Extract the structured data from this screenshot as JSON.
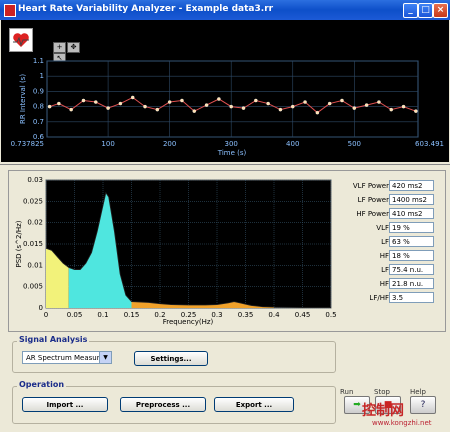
{
  "window": {
    "title": "Heart Rate Variability Analyzer  -  Example data3.rr",
    "buttons": {
      "minimize": "_",
      "maximize": "□",
      "close": "×"
    }
  },
  "rr_chart": {
    "toolbar_icons": [
      "zoom-icon",
      "pan-icon",
      "cursor-icon"
    ],
    "ylabel": "RR Interval (s)",
    "xlabel": "Time (s)",
    "x_start_label": "0.737825",
    "x_end_label": "603.491",
    "x_ticks": [
      "100",
      "200",
      "300",
      "400",
      "500"
    ],
    "y_ticks": [
      "1.1",
      "1",
      "0.9",
      "0.8",
      "0.7",
      "0.6"
    ]
  },
  "chart_data": [
    {
      "type": "scatter",
      "xlabel": "Time (s)",
      "ylabel": "RR Interval (s)",
      "xlim": [
        0.737825,
        603.491
      ],
      "ylim": [
        0.6,
        1.1
      ],
      "series": [
        {
          "x": [
            5,
            20,
            40,
            60,
            80,
            100,
            120,
            140,
            160,
            180,
            200,
            220,
            240,
            260,
            280,
            300,
            320,
            340,
            360,
            380,
            400,
            420,
            440,
            460,
            480,
            500,
            520,
            540,
            560,
            580,
            600
          ],
          "values": [
            0.8,
            0.82,
            0.78,
            0.84,
            0.83,
            0.79,
            0.82,
            0.86,
            0.8,
            0.78,
            0.83,
            0.84,
            0.77,
            0.81,
            0.85,
            0.8,
            0.79,
            0.84,
            0.82,
            0.78,
            0.8,
            0.83,
            0.76,
            0.82,
            0.84,
            0.79,
            0.81,
            0.83,
            0.78,
            0.8,
            0.77
          ]
        }
      ]
    },
    {
      "type": "area",
      "xlabel": "Frequency(Hz)",
      "ylabel": "PSD (s^2/Hz)",
      "xlim": [
        0,
        0.5
      ],
      "ylim": [
        0,
        0.03
      ],
      "x": [
        0,
        0.01,
        0.02,
        0.03,
        0.04,
        0.05,
        0.06,
        0.07,
        0.08,
        0.09,
        0.1,
        0.105,
        0.11,
        0.12,
        0.13,
        0.14,
        0.15,
        0.18,
        0.2,
        0.22,
        0.25,
        0.28,
        0.3,
        0.32,
        0.33,
        0.34,
        0.36,
        0.38,
        0.4,
        0.45,
        0.5
      ],
      "values": [
        0.014,
        0.0135,
        0.012,
        0.0105,
        0.0095,
        0.009,
        0.009,
        0.0105,
        0.013,
        0.018,
        0.024,
        0.027,
        0.026,
        0.018,
        0.008,
        0.003,
        0.0015,
        0.0013,
        0.001,
        0.0008,
        0.0007,
        0.0007,
        0.0008,
        0.0012,
        0.0015,
        0.0012,
        0.0006,
        0.0003,
        0.0002,
        0.0001,
        0.0001
      ],
      "bands": [
        {
          "range": [
            0,
            0.04
          ],
          "color": "#f2f27a"
        },
        {
          "range": [
            0.04,
            0.15
          ],
          "color": "#4fe6df"
        },
        {
          "range": [
            0.15,
            0.4
          ],
          "color": "#f0a12a"
        }
      ],
      "x_ticks": [
        "0",
        "0.05",
        "0.1",
        "0.15",
        "0.2",
        "0.25",
        "0.3",
        "0.35",
        "0.4",
        "0.45",
        "0.5"
      ],
      "y_ticks": [
        "0.03",
        "0.025",
        "0.02",
        "0.015",
        "0.01",
        "0.005",
        "0"
      ]
    }
  ],
  "measures": [
    {
      "label": "VLF Power",
      "value": "420 ms2"
    },
    {
      "label": "LF Power",
      "value": "1400 ms2"
    },
    {
      "label": "HF Power",
      "value": "410 ms2"
    },
    {
      "label": "VLF",
      "value": "19 %"
    },
    {
      "label": "LF",
      "value": "63 %"
    },
    {
      "label": "HF",
      "value": "18 %"
    },
    {
      "label": "LF",
      "value": "75.4 n.u."
    },
    {
      "label": "HF",
      "value": "21.8 n.u."
    },
    {
      "label": "LF/HF",
      "value": "3.5"
    }
  ],
  "signal_analysis": {
    "title": "Signal Analysis",
    "select_value": "AR Spectrum Measures",
    "settings_button": "Settings..."
  },
  "operation": {
    "title": "Operation",
    "import": "Import ...",
    "preprocess": "Preprocess ...",
    "export": "Export ..."
  },
  "controls": {
    "run": "Run",
    "stop": "Stop",
    "help": "Help"
  },
  "watermark": {
    "text": "控制网",
    "url": "www.kongzhi.net"
  },
  "colors": {
    "titlebar": "#0d4fc9",
    "plot_bg": "#000000",
    "grid": "#4a6a8a",
    "trace": "#ffd08a"
  }
}
